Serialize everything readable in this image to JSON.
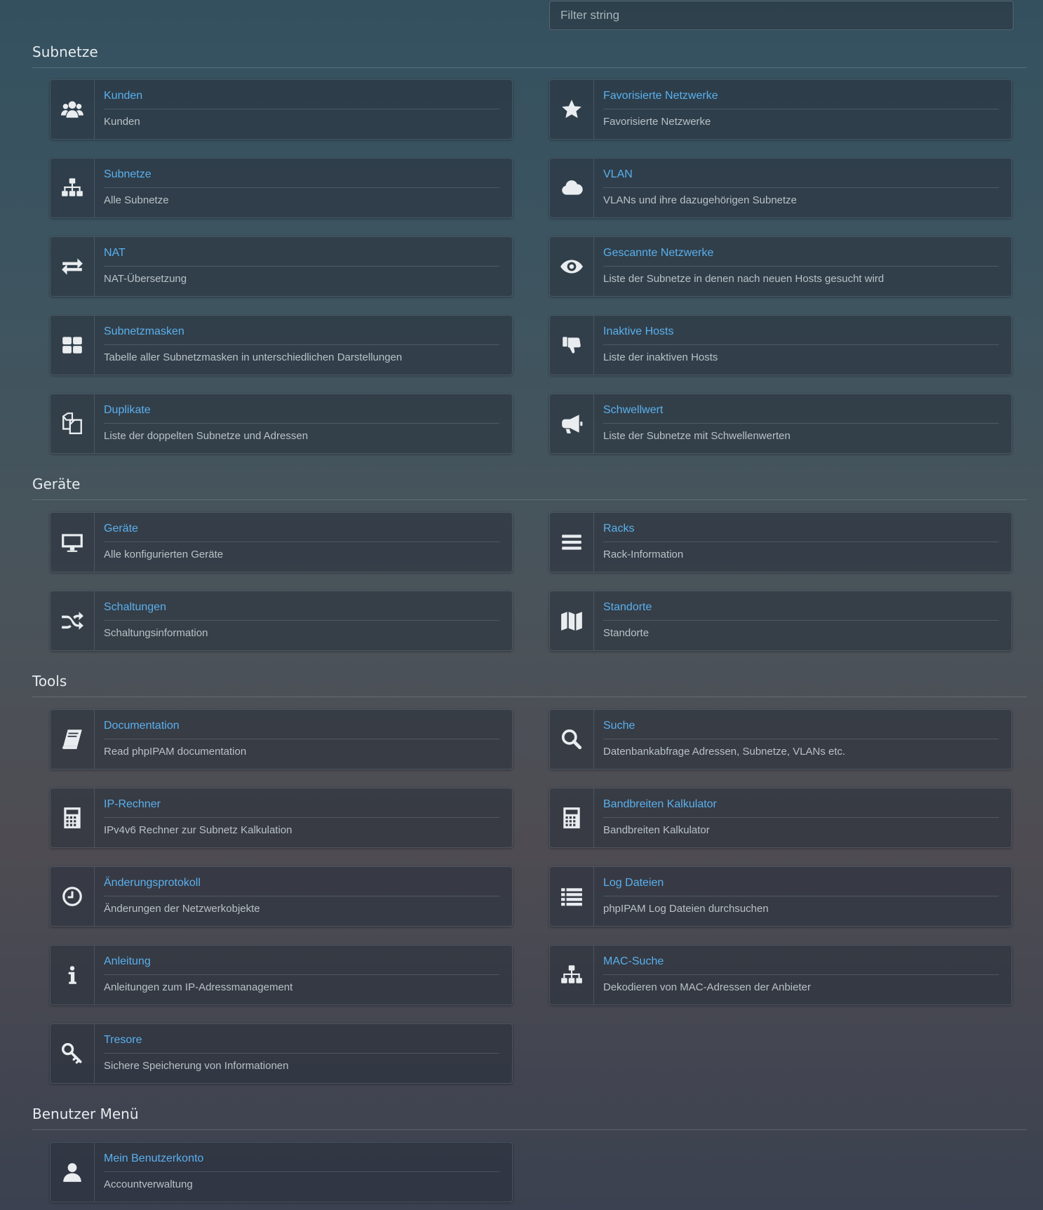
{
  "filter": {
    "placeholder": "Filter string"
  },
  "sections": {
    "subnetze": {
      "title": "Subnetze"
    },
    "geraete": {
      "title": "Geräte"
    },
    "tools": {
      "title": "Tools"
    },
    "benutzer": {
      "title": "Benutzer Menü"
    }
  },
  "cards": {
    "kunden": {
      "title": "Kunden",
      "desc": "Kunden",
      "icon": "users-icon"
    },
    "favoriten": {
      "title": "Favorisierte Netzwerke",
      "desc": "Favorisierte Netzwerke",
      "icon": "star-icon"
    },
    "subnetze": {
      "title": "Subnetze",
      "desc": "Alle Subnetze",
      "icon": "sitemap-icon"
    },
    "vlan": {
      "title": "VLAN",
      "desc": "VLANs und ihre dazugehörigen Subnetze",
      "icon": "cloud-icon"
    },
    "nat": {
      "title": "NAT",
      "desc": "NAT-Übersetzung",
      "icon": "exchange-icon"
    },
    "gescannt": {
      "title": "Gescannte Netzwerke",
      "desc": "Liste der Subnetze in denen nach neuen Hosts gesucht wird",
      "icon": "eye-icon"
    },
    "masken": {
      "title": "Subnetzmasken",
      "desc": "Tabelle aller Subnetzmasken in unterschiedlichen Darstellungen",
      "icon": "grid-icon"
    },
    "inaktiv": {
      "title": "Inaktive Hosts",
      "desc": "Liste der inaktiven Hosts",
      "icon": "thumbs-down-icon"
    },
    "duplikate": {
      "title": "Duplikate",
      "desc": "Liste der doppelten Subnetze und Adressen",
      "icon": "copy-icon"
    },
    "schwellwert": {
      "title": "Schwellwert",
      "desc": "Liste der Subnetze mit Schwellenwerten",
      "icon": "bullhorn-icon"
    },
    "geraete": {
      "title": "Geräte",
      "desc": "Alle konfigurierten Geräte",
      "icon": "desktop-icon"
    },
    "racks": {
      "title": "Racks",
      "desc": "Rack-Information",
      "icon": "bars-icon"
    },
    "schaltungen": {
      "title": "Schaltungen",
      "desc": "Schaltungsinformation",
      "icon": "random-icon"
    },
    "standorte": {
      "title": "Standorte",
      "desc": "Standorte",
      "icon": "map-icon"
    },
    "doku": {
      "title": "Documentation",
      "desc": "Read phpIPAM documentation",
      "icon": "book-icon"
    },
    "suche": {
      "title": "Suche",
      "desc": "Datenbankabfrage Adressen, Subnetze, VLANs etc.",
      "icon": "search-icon"
    },
    "iprechner": {
      "title": "IP-Rechner",
      "desc": "IPv4v6 Rechner zur Subnetz Kalkulation",
      "icon": "calculator-icon"
    },
    "bandbreite": {
      "title": "Bandbreiten Kalkulator",
      "desc": "Bandbreiten Kalkulator",
      "icon": "calculator-icon"
    },
    "aenderung": {
      "title": "Änderungsprotokoll",
      "desc": "Änderungen der Netzwerkobjekte",
      "icon": "clock-icon"
    },
    "log": {
      "title": "Log Dateien",
      "desc": "phpIPAM Log Dateien durchsuchen",
      "icon": "list-icon"
    },
    "anleitung": {
      "title": "Anleitung",
      "desc": "Anleitungen zum IP-Adressmanagement",
      "icon": "info-icon"
    },
    "mac": {
      "title": "MAC-Suche",
      "desc": "Dekodieren von MAC-Adressen der Anbieter",
      "icon": "sitemap-icon"
    },
    "tresore": {
      "title": "Tresore",
      "desc": "Sichere Speicherung von Informationen",
      "icon": "key-icon"
    },
    "konto": {
      "title": "Mein Benutzerkonto",
      "desc": "Accountverwaltung",
      "icon": "user-icon"
    }
  }
}
